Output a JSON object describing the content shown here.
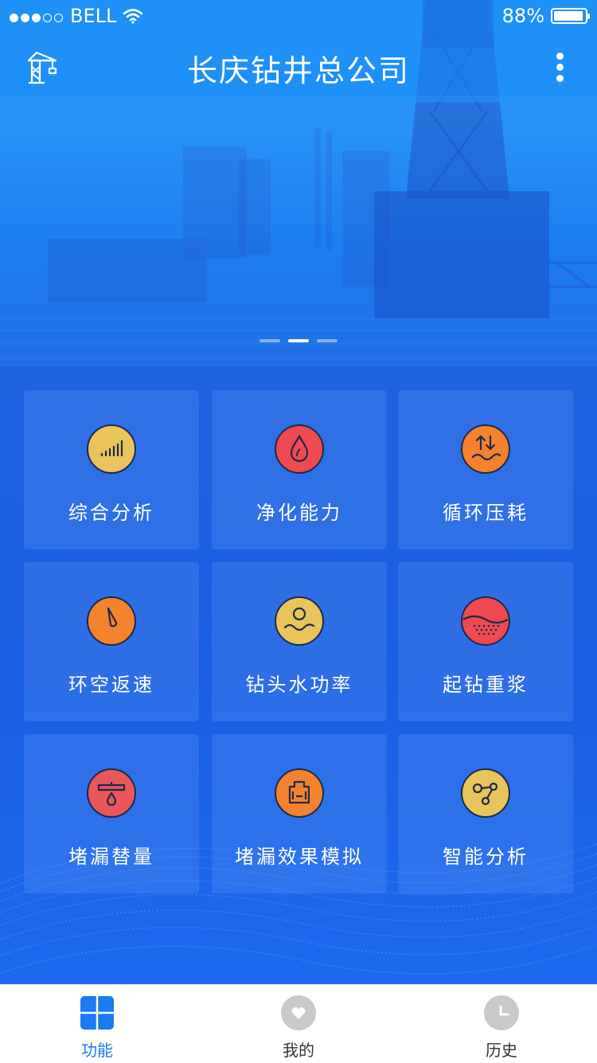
{
  "status_bar": {
    "carrier": "BELL",
    "battery_text": "88%",
    "signal_bars_filled": 3,
    "signal_bars_total": 5,
    "battery_level": 0.88
  },
  "header": {
    "title": "长庆钻井总公司",
    "left_icon": "drilling-rig-icon",
    "right_icon": "more-vertical-icon"
  },
  "carousel": {
    "page_count": 3,
    "active_index": 1
  },
  "functions": [
    {
      "label": "综合分析",
      "icon": "signal-bars-icon",
      "color": "#e9c45a"
    },
    {
      "label": "净化能力",
      "icon": "water-drop-icon",
      "color": "#ef4a4f"
    },
    {
      "label": "循环压耗",
      "icon": "pressure-flow-icon",
      "color": "#f5822d"
    },
    {
      "label": "环空返速",
      "icon": "speed-pointer-icon",
      "color": "#f5822d"
    },
    {
      "label": "钻头水功率",
      "icon": "water-power-icon",
      "color": "#e9c45a"
    },
    {
      "label": "起钻重浆",
      "icon": "heavy-mud-icon",
      "color": "#ef4a4f"
    },
    {
      "label": "堵漏替量",
      "icon": "leak-plug-icon",
      "color": "#e9575a"
    },
    {
      "label": "堵漏效果模拟",
      "icon": "simulation-icon",
      "color": "#f5822d"
    },
    {
      "label": "智能分析",
      "icon": "network-nodes-icon",
      "color": "#e9c45a"
    }
  ],
  "tabbar": {
    "items": [
      {
        "label": "功能",
        "icon": "grid-tiles-icon",
        "active": true
      },
      {
        "label": "我的",
        "icon": "heart-icon",
        "active": false
      },
      {
        "label": "历史",
        "icon": "clock-icon",
        "active": false
      }
    ],
    "active_color": "#1a7af0"
  }
}
